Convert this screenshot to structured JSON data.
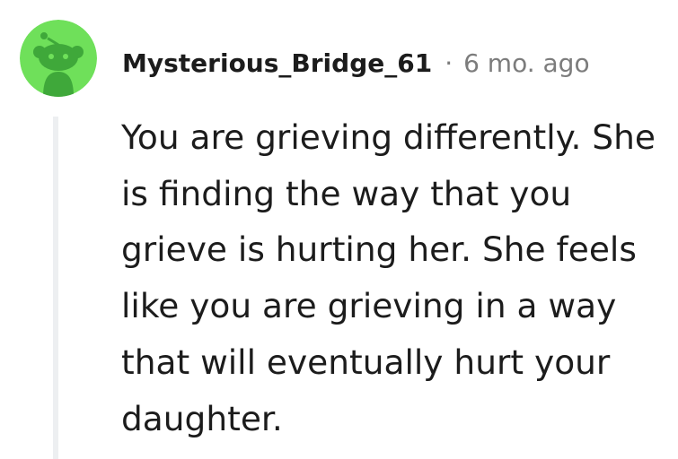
{
  "comment": {
    "author": "Mysterious_Bridge_61",
    "separator": "·",
    "timestamp": "6 mo. ago",
    "avatar_icon": "snoo-avatar-icon",
    "avatar_bg": "#6fe05a",
    "body": "You are grieving differently. She is finding the way that you grieve is hurting her. She feels like you are grieving in a way that will eventually hurt your daughter."
  }
}
